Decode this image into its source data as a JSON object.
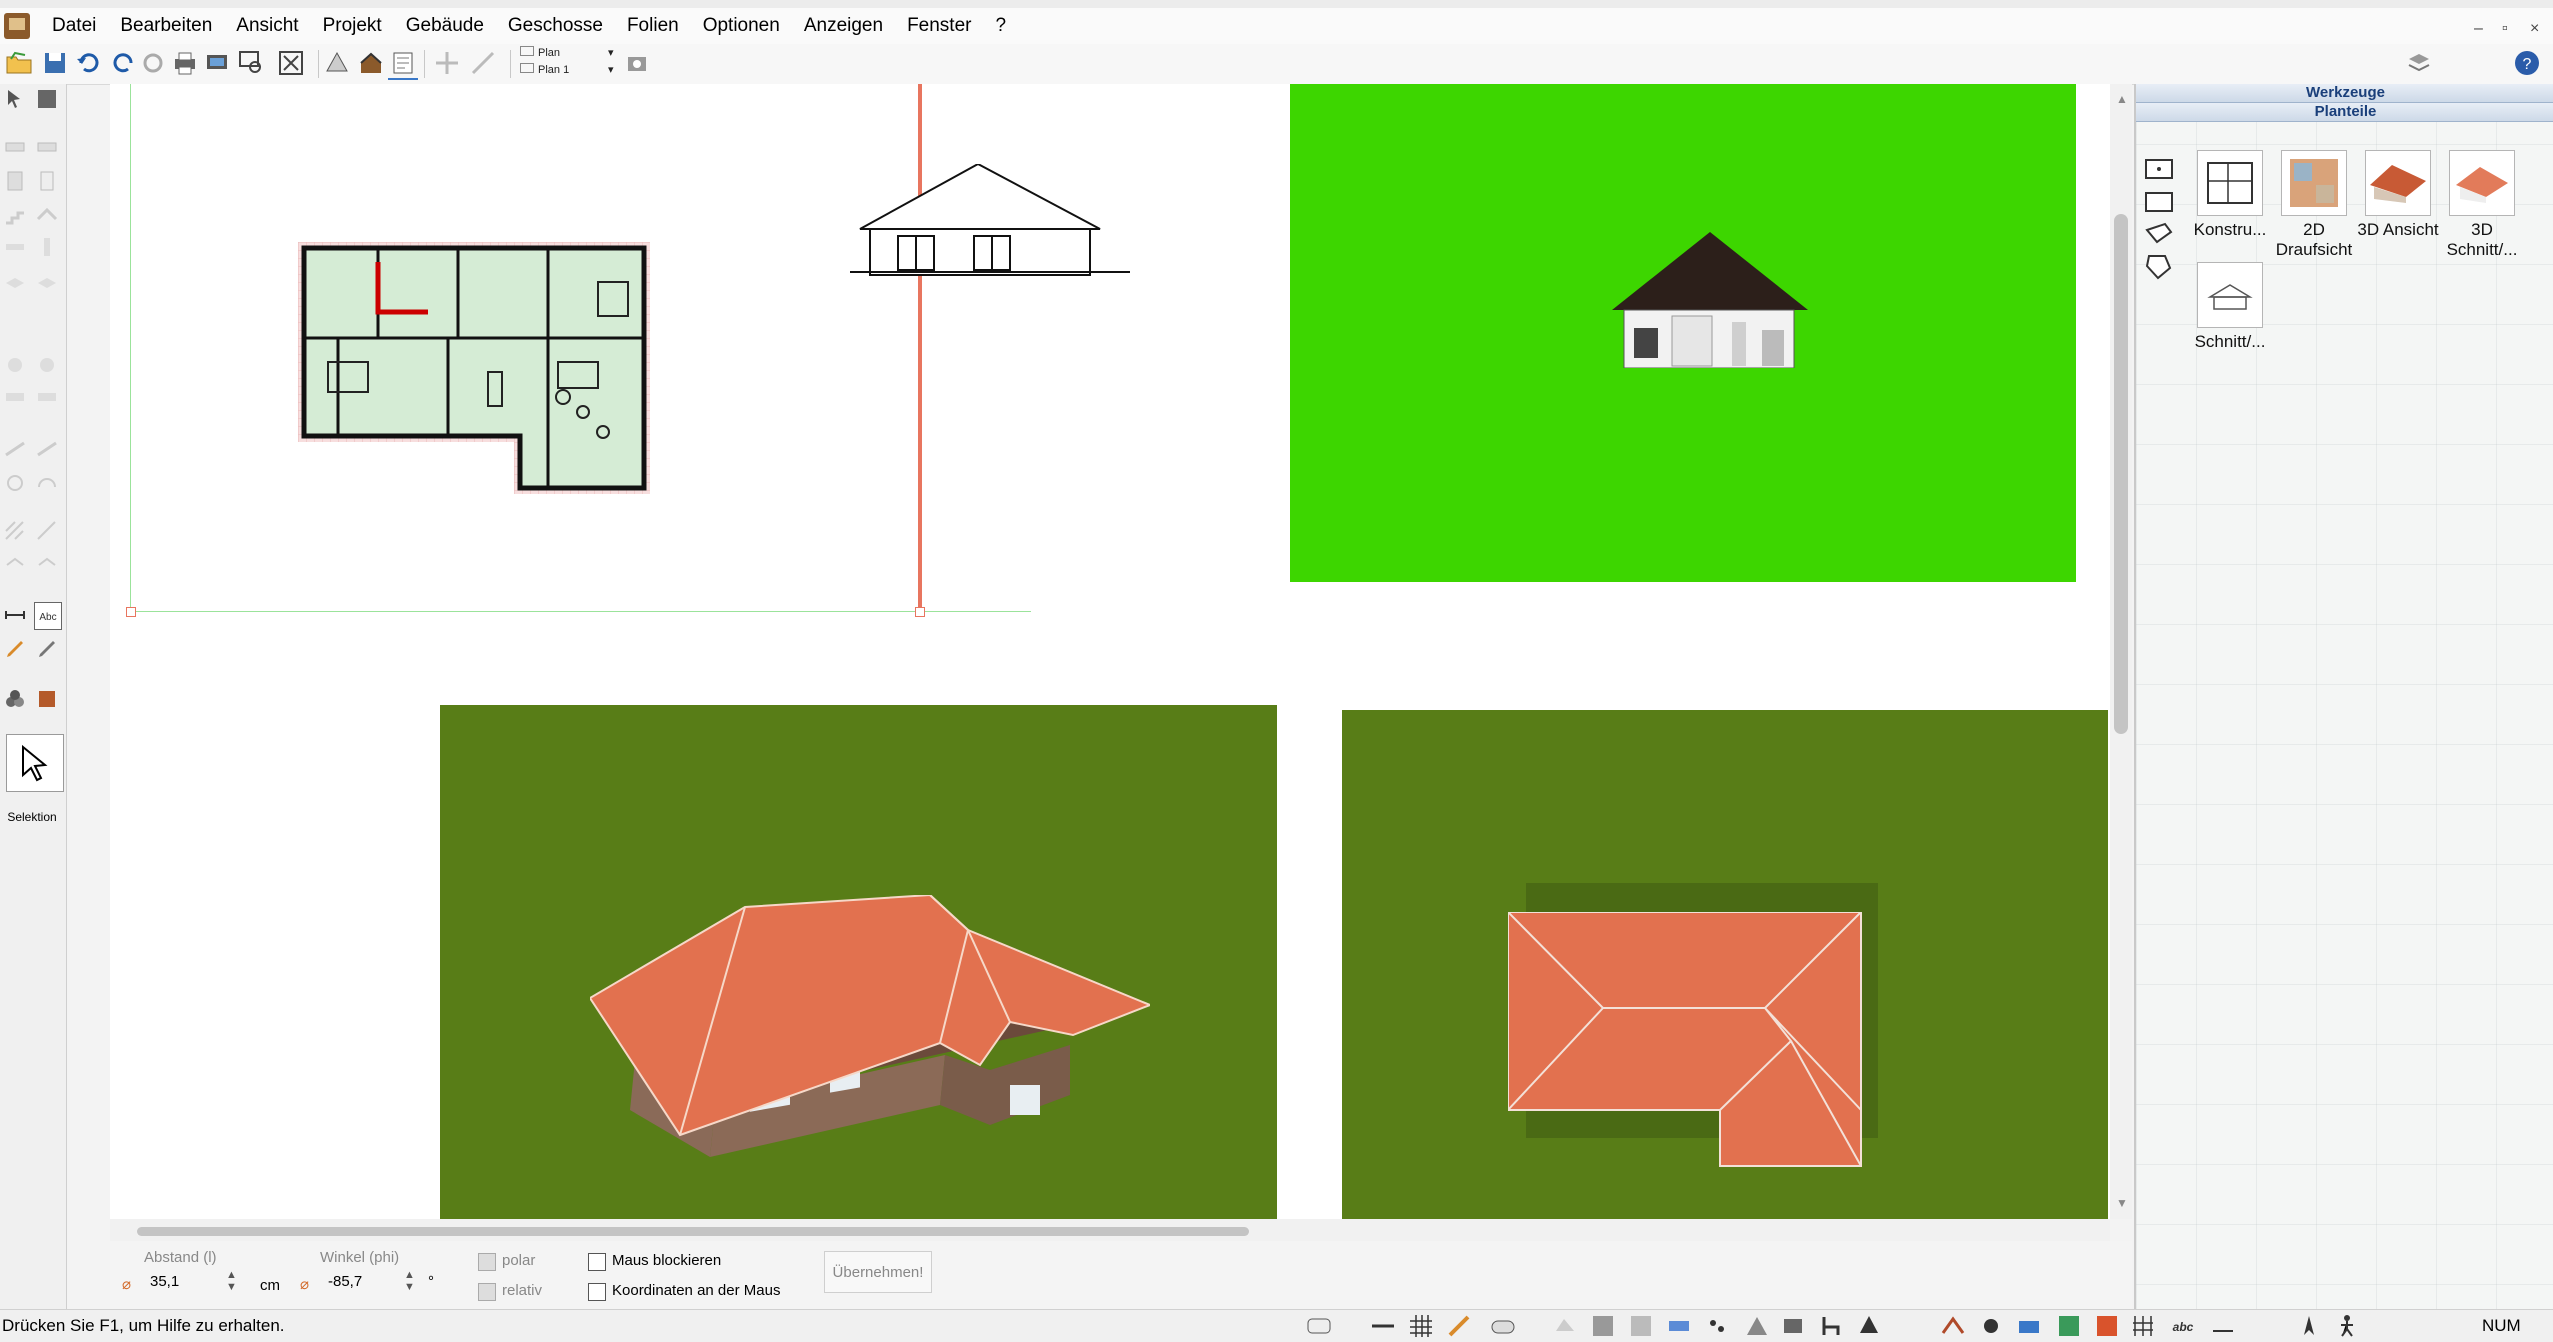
{
  "menu": {
    "items": [
      "Datei",
      "Bearbeiten",
      "Ansicht",
      "Projekt",
      "Gebäude",
      "Geschosse",
      "Folien",
      "Optionen",
      "Anzeigen",
      "Fenster",
      "?"
    ]
  },
  "window_controls": {
    "minimize": "–",
    "restore": "▫",
    "close": "×"
  },
  "toolbar": {
    "plan_top": "Plan",
    "plan_bottom": "Plan 1"
  },
  "left_tools": {
    "selection_label": "Selektion"
  },
  "right_panel": {
    "header_werkzeuge": "Werkzeuge",
    "header_planteile": "Planteile",
    "tiles": [
      {
        "label": "Konstru...",
        "icon": "construction-plan-icon"
      },
      {
        "label": "2D Draufsicht",
        "icon": "floorplan-2d-icon"
      },
      {
        "label": "3D Ansicht",
        "icon": "house-3d-icon"
      },
      {
        "label": "3D Schnitt/...",
        "icon": "section-3d-icon"
      },
      {
        "label": "Schnitt/...",
        "icon": "section-icon"
      }
    ]
  },
  "input_bar": {
    "abstand_label": "Abstand (l)",
    "abstand_value": "35,1",
    "abstand_unit": "cm",
    "winkel_label": "Winkel (phi)",
    "winkel_value": "-85,7",
    "winkel_unit": "°",
    "polar_label": "polar",
    "relativ_label": "relativ",
    "maus_blockieren_label": "Maus blockieren",
    "koordinaten_label": "Koordinaten an der Maus",
    "uebernehmen_label": "Übernehmen!"
  },
  "status": {
    "text": "Drücken Sie F1, um Hilfe zu erhalten.",
    "num": "NUM"
  },
  "colors": {
    "viewport_green": "#3dd600",
    "lawn": "#587d17",
    "roof": "#e2714f",
    "selection_line": "#e8755f"
  }
}
